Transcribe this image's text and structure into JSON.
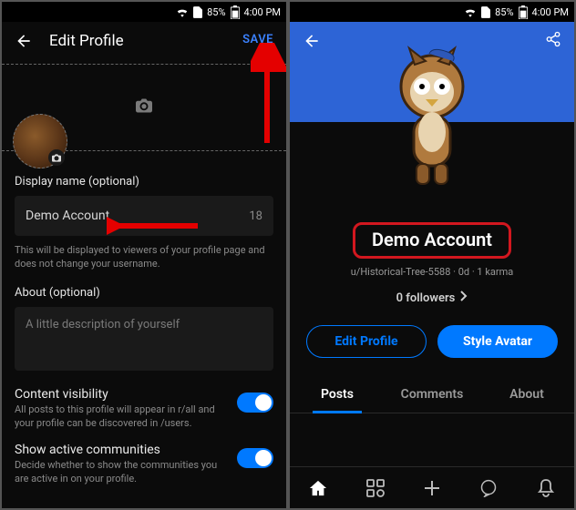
{
  "status_bar": {
    "battery_pct": "85%",
    "time": "4:00 PM"
  },
  "left": {
    "header_title": "Edit Profile",
    "save_label": "SAVE",
    "display_name_label": "Display name (optional)",
    "display_name_value": "Demo Account",
    "display_name_chars_left": "18",
    "display_name_helper": "This will be displayed to viewers of your profile page and does not change your username.",
    "about_label": "About (optional)",
    "about_placeholder": "A little description of yourself",
    "content_visibility_title": "Content visibility",
    "content_visibility_sub": "All posts to this profile will appear in r/all and your profile can be discovered in /users.",
    "show_active_title": "Show active communities",
    "show_active_sub": "Decide whether to show the communities you are active in on your profile."
  },
  "right": {
    "display_name": "Demo Account",
    "username_line": "u/Historical-Tree-5588 · 0d · 1 karma",
    "followers_line": "0 followers",
    "edit_profile_btn": "Edit Profile",
    "style_avatar_btn": "Style Avatar",
    "tabs": {
      "posts": "Posts",
      "comments": "Comments",
      "about": "About"
    }
  }
}
